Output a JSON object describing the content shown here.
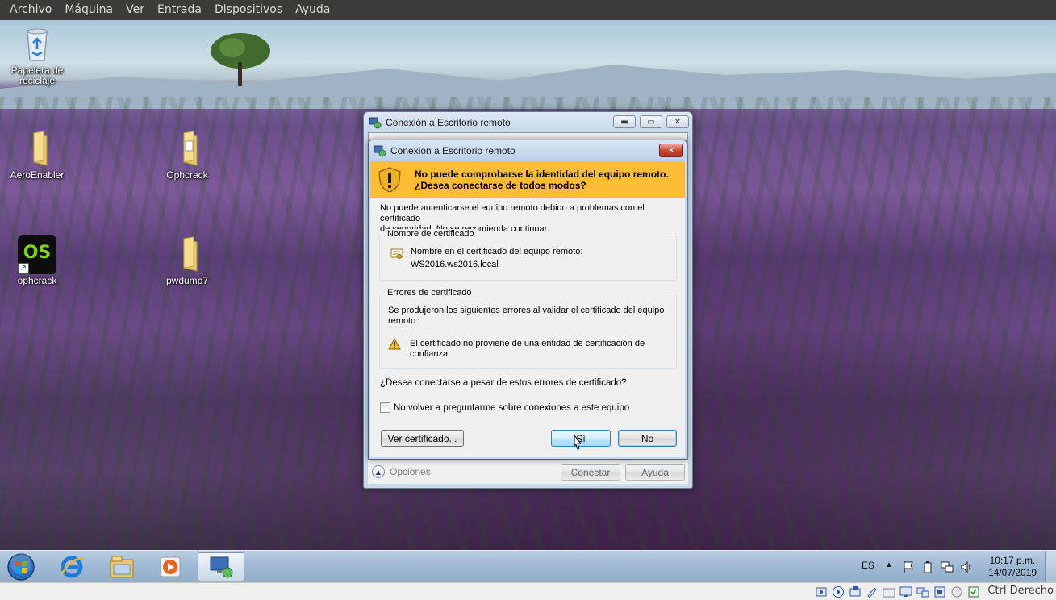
{
  "vbox_menu": [
    "Archivo",
    "Máquina",
    "Ver",
    "Entrada",
    "Dispositivos",
    "Ayuda"
  ],
  "desktop_icons": [
    {
      "label": "Papelera de reciclaje",
      "icon": "recycle-bin-icon"
    },
    {
      "label": "AeroEnabler",
      "icon": "folder-icon"
    },
    {
      "label": "Ophcrack",
      "icon": "folder-icon"
    },
    {
      "label": "ophcrack",
      "icon": "ophcrack-icon",
      "glyph": "OS"
    },
    {
      "label": "pwdump7",
      "icon": "folder-icon"
    }
  ],
  "rdp_window": {
    "title": "Conexión a Escritorio remoto",
    "options_label": "Opciones",
    "connect_label": "Conectar",
    "help_label": "Ayuda"
  },
  "dialog": {
    "title": "Conexión a Escritorio remoto",
    "close_glyph": "✕",
    "warning_line1": "No puede comprobarse la identidad del equipo remoto.",
    "warning_line2": "¿Desea conectarse de todos modos?",
    "intro_line1": "No puede autenticarse el equipo remoto debido a problemas con el certificado",
    "intro_line2": "de seguridad. No se recomienda continuar.",
    "cert_name_group": "Nombre de certificado",
    "cert_name_label": "Nombre en el certificado del equipo remoto:",
    "cert_name_value": "WS2016.ws2016.local",
    "cert_errors_group": "Errores de certificado",
    "errors_intro_line1": "Se produjeron los siguientes errores al validar el certificado del equipo",
    "errors_intro_line2": "remoto:",
    "error_line1": "El certificado no proviene de una entidad de certificación de",
    "error_line2": "confianza.",
    "question": "¿Desea conectarse a pesar de estos errores de certificado?",
    "dont_ask_label": "No volver a preguntarme sobre conexiones a este equipo",
    "dont_ask_checked": false,
    "view_cert_label": "Ver certificado...",
    "yes_label": "Sí",
    "no_label": "No"
  },
  "taskbar": {
    "apps": [
      "internet-explorer-icon",
      "file-explorer-icon",
      "media-player-icon",
      "remote-desktop-icon"
    ],
    "language": "ES",
    "time": "10:17 p.m.",
    "date": "14/07/2019"
  },
  "vbox_status": {
    "host_key": "Ctrl Derecho"
  },
  "colors": {
    "warning_banner": "#fcbc33",
    "vbox_menubar": "#3c3b37",
    "taskbar": "#a8c0d8"
  }
}
